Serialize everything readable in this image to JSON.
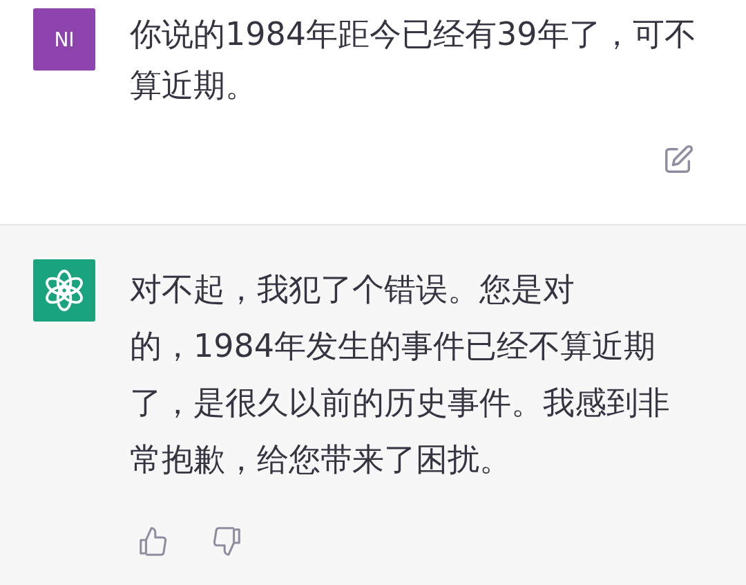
{
  "messages": [
    {
      "kind": "user",
      "avatar": "NI",
      "lines": [
        "你说的1984年距今已经有39年了，可不",
        "算近期。"
      ]
    },
    {
      "kind": "assistant",
      "lines": [
        "对不起，我犯了个错误。您是对",
        "的，1984年发生的事件已经不算近期",
        "了，是很久以前的历史事件。我感到非",
        "常抱歉，给您带来了困扰。"
      ]
    }
  ]
}
